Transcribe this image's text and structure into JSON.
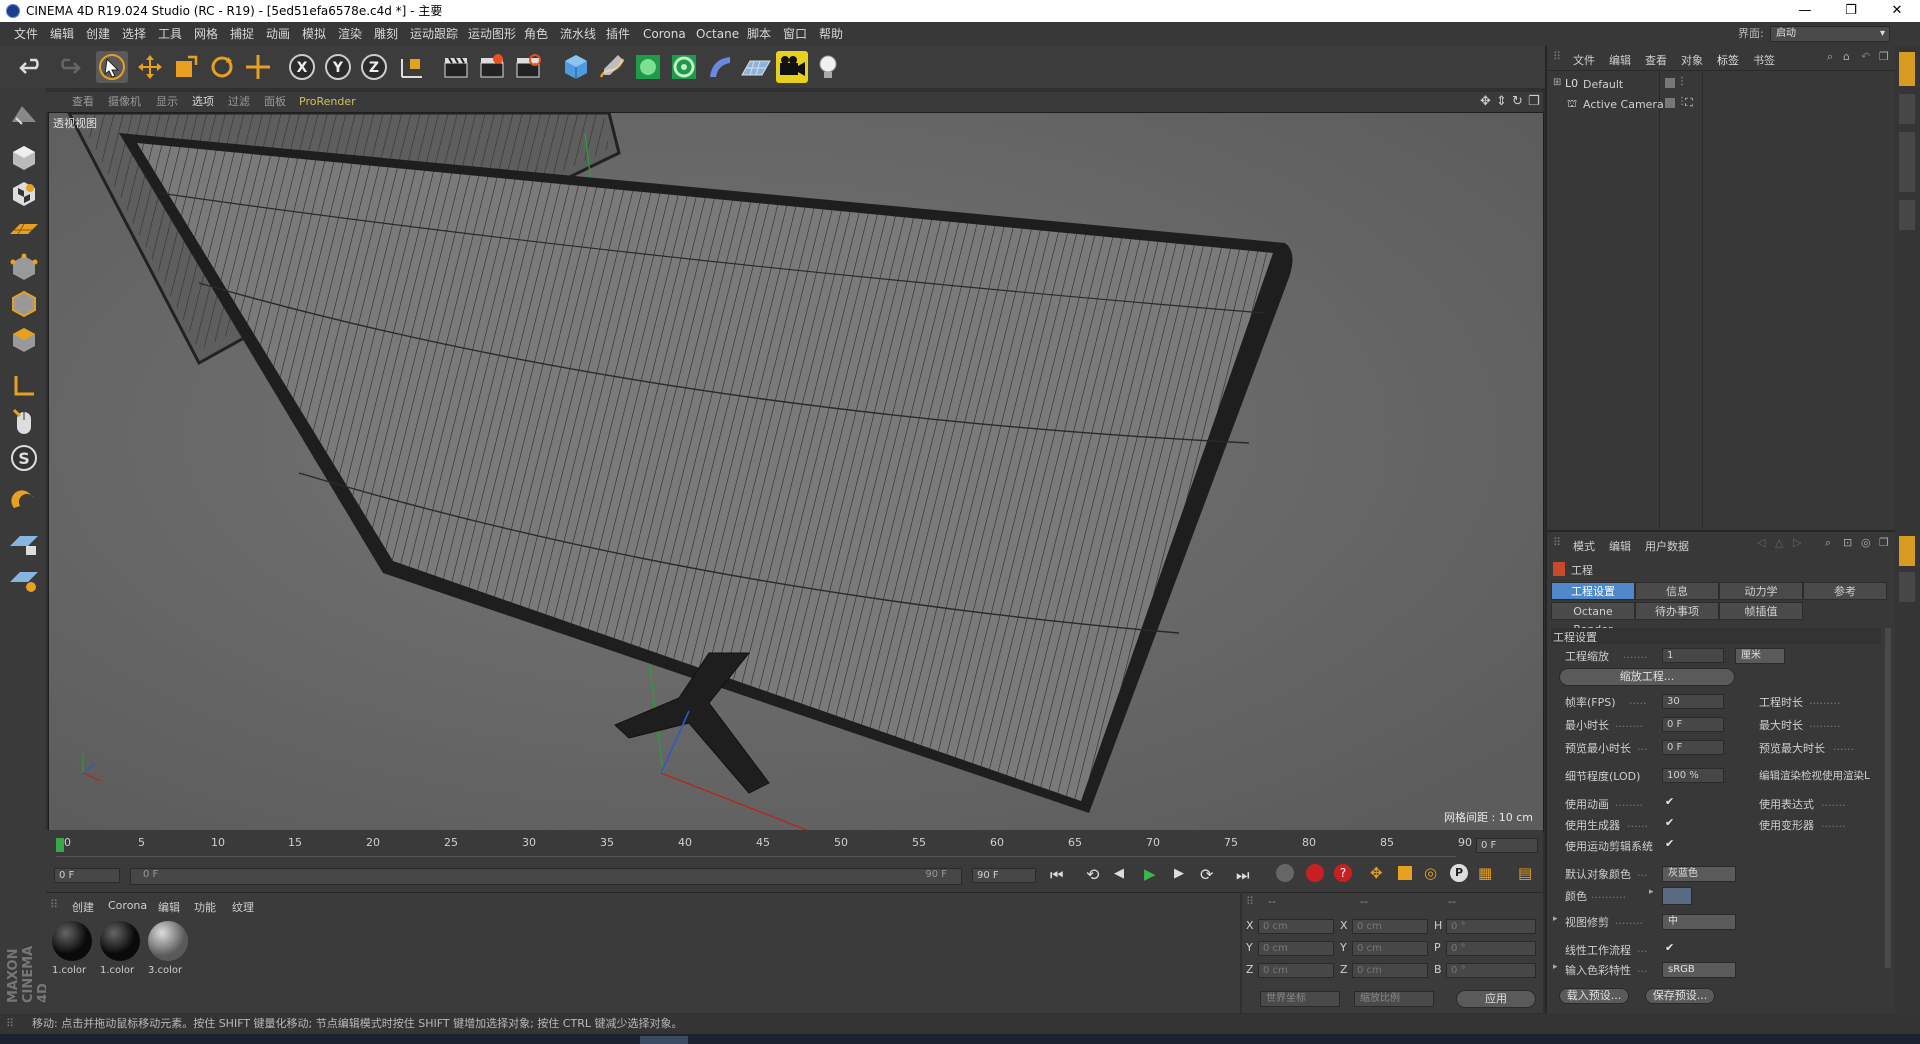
{
  "window": {
    "title": "CINEMA 4D R19.024 Studio (RC - R19) - [5ed51efa6578e.c4d *] - 主要",
    "controls": [
      "—",
      "❐",
      "✕"
    ]
  },
  "menubar": {
    "items": [
      "文件",
      "编辑",
      "创建",
      "选择",
      "工具",
      "网格",
      "捕捉",
      "动画",
      "模拟",
      "渲染",
      "雕刻",
      "运动跟踪",
      "运动图形",
      "角色",
      "流水线",
      "插件",
      "Corona",
      "Octane",
      "脚本",
      "窗口",
      "帮助"
    ],
    "layout_label": "界面:",
    "layout_value": "启动"
  },
  "viewport": {
    "menu": [
      "查看",
      "摄像机",
      "显示",
      "选项",
      "过滤",
      "面板",
      "ProRender"
    ],
    "name": "透视视图",
    "grid_spacing": "网格间距 : 10 cm"
  },
  "timeline": {
    "ticks": [
      "0",
      "5",
      "10",
      "15",
      "20",
      "25",
      "30",
      "35",
      "40",
      "45",
      "50",
      "55",
      "60",
      "65",
      "70",
      "75",
      "80",
      "85",
      "90"
    ],
    "current_frame": "0 F",
    "start": "0 F",
    "range_start": "0 F",
    "range_end": "90 F",
    "end": "90 F"
  },
  "material_panel": {
    "menu": [
      "创建",
      "Corona",
      "编辑",
      "功能",
      "纹理"
    ],
    "materials": [
      "1.color",
      "1.color",
      "3.color"
    ]
  },
  "coord_panel": {
    "header": [
      "--",
      "--",
      "--"
    ],
    "rows": [
      {
        "a": "X",
        "a_val": "0 cm",
        "b": "X",
        "b_val": "0 cm",
        "c": "H",
        "c_val": "0 °"
      },
      {
        "a": "Y",
        "a_val": "0 cm",
        "b": "Y",
        "b_val": "0 cm",
        "c": "P",
        "c_val": "0 °"
      },
      {
        "a": "Z",
        "a_val": "0 cm",
        "b": "Z",
        "b_val": "0 cm",
        "c": "B",
        "c_val": "0 °"
      }
    ],
    "mode1": "世界坐标",
    "mode2": "缩放比例",
    "apply": "应用"
  },
  "object_panel": {
    "menu": [
      "文件",
      "编辑",
      "查看",
      "对象",
      "标签",
      "书签"
    ],
    "objects": [
      "Default",
      "Active Camera"
    ]
  },
  "attr_panel": {
    "menu": [
      "模式",
      "编辑",
      "用户数据"
    ],
    "title": "工程",
    "tabs_row1": [
      "工程设置",
      "信息",
      "动力学",
      "参考"
    ],
    "tabs_row2": [
      "Octane Render",
      "待办事项",
      "帧插值"
    ],
    "section": "工程设置",
    "scale_label": "工程缩放",
    "scale_value": "1",
    "scale_unit": "厘米",
    "scale_btn": "缩放工程...",
    "fps_label": "帧率(FPS)",
    "fps_value": "30",
    "duration_label": "工程时长",
    "min_label": "最小时长",
    "min_value": "0 F",
    "max_label": "最大时长",
    "pmin_label": "预览最小时长",
    "pmin_value": "0 F",
    "pmax_label": "预览最大时长",
    "lod_label": "细节程度(LOD)",
    "lod_value": "100 %",
    "lod_right": "编辑渲染检视使用渲染L",
    "anim_label": "使用动画",
    "expr_label": "使用表达式",
    "gen_label": "使用生成器",
    "deform_label": "使用变形器",
    "mograph_label": "使用运动剪辑系统",
    "objcolor_label": "默认对象颜色",
    "objcolor_value": "灰蓝色",
    "color_label": "颜色",
    "clip_label": "视图修剪",
    "clip_value": "中",
    "linear_label": "线性工作流程",
    "colorprofile_label": "输入色彩特性",
    "colorprofile_value": "sRGB",
    "load_btn": "载入预设...",
    "save_btn": "保存预设..."
  },
  "status": {
    "text": "移动: 点击并拖动鼠标移动元素。按住 SHIFT 键量化移动; 节点编辑模式时按住 SHIFT 键增加选择对象; 按住 CTRL 键减少选择对象。"
  },
  "colors": {
    "accent": "#4e88c8",
    "viewport_bg": "#6c6c6c",
    "panel_bg": "#383838"
  }
}
